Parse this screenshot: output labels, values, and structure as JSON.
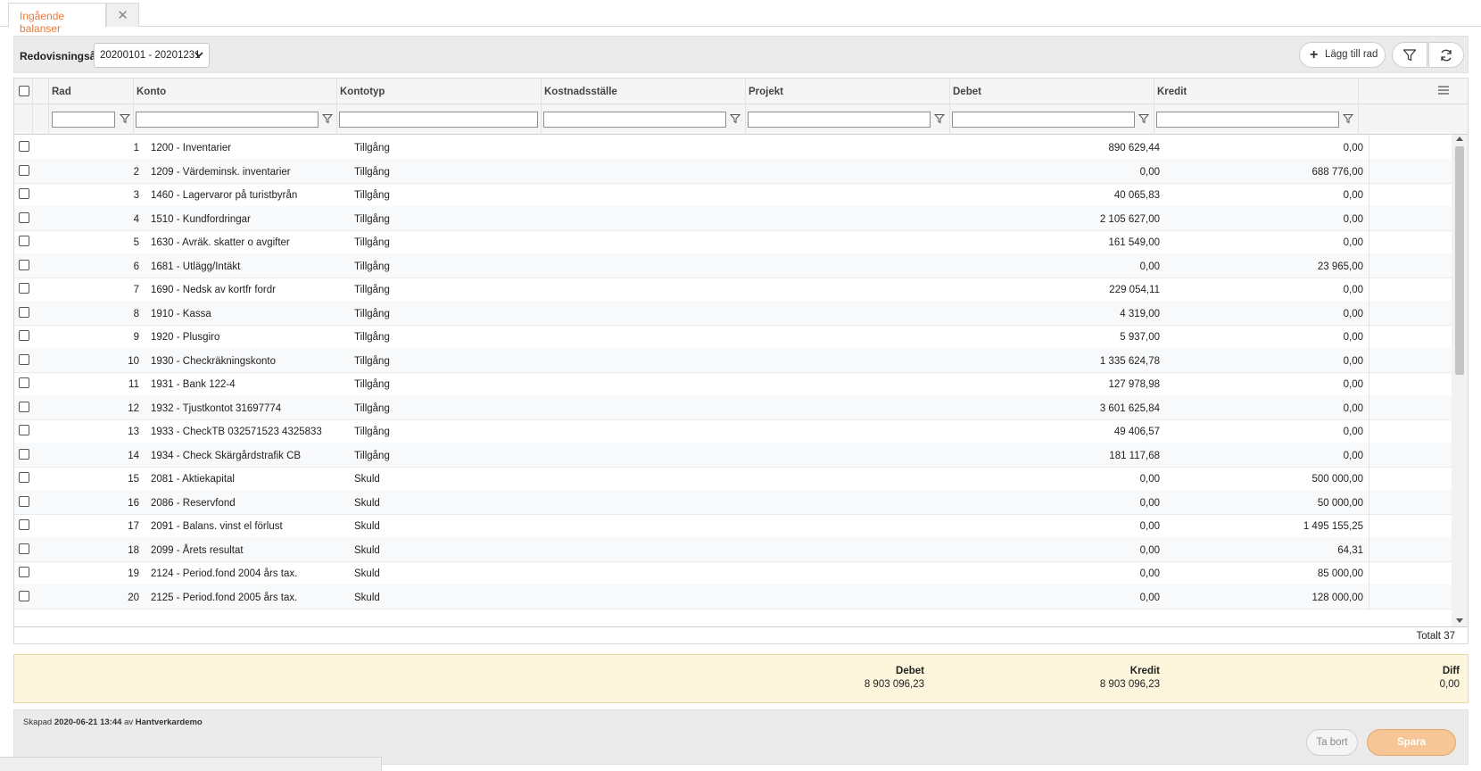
{
  "tabs": {
    "active_label": "Ingående balanser",
    "close_symbol": "✕"
  },
  "toolbar": {
    "year_label": "Redovisningsår",
    "year_value": "20200101 - 20201231",
    "add_row_label": "Lägg till rad"
  },
  "grid": {
    "columns": {
      "rad": "Rad",
      "konto": "Konto",
      "kontotyp": "Kontotyp",
      "kostnadsstalle": "Kostnadsställe",
      "projekt": "Projekt",
      "debet": "Debet",
      "kredit": "Kredit"
    },
    "rows": [
      {
        "rad": "1",
        "konto": "1200 - Inventarier",
        "typ": "Tillgång",
        "debet": "890 629,44",
        "kredit": "0,00"
      },
      {
        "rad": "2",
        "konto": "1209 - Värdeminsk. inventarier",
        "typ": "Tillgång",
        "debet": "0,00",
        "kredit": "688 776,00"
      },
      {
        "rad": "3",
        "konto": "1460 - Lagervaror på turistbyrån",
        "typ": "Tillgång",
        "debet": "40 065,83",
        "kredit": "0,00"
      },
      {
        "rad": "4",
        "konto": "1510 - Kundfordringar",
        "typ": "Tillgång",
        "debet": "2 105 627,00",
        "kredit": "0,00"
      },
      {
        "rad": "5",
        "konto": "1630 - Avräk. skatter o avgifter",
        "typ": "Tillgång",
        "debet": "161 549,00",
        "kredit": "0,00"
      },
      {
        "rad": "6",
        "konto": "1681 - Utlägg/Intäkt",
        "typ": "Tillgång",
        "debet": "0,00",
        "kredit": "23 965,00"
      },
      {
        "rad": "7",
        "konto": "1690 - Nedsk av kortfr fordr",
        "typ": "Tillgång",
        "debet": "229 054,11",
        "kredit": "0,00"
      },
      {
        "rad": "8",
        "konto": "1910 - Kassa",
        "typ": "Tillgång",
        "debet": "4 319,00",
        "kredit": "0,00"
      },
      {
        "rad": "9",
        "konto": "1920 - Plusgiro",
        "typ": "Tillgång",
        "debet": "5 937,00",
        "kredit": "0,00"
      },
      {
        "rad": "10",
        "konto": "1930 - Checkräkningskonto",
        "typ": "Tillgång",
        "debet": "1 335 624,78",
        "kredit": "0,00"
      },
      {
        "rad": "11",
        "konto": "1931 - Bank 122-4",
        "typ": "Tillgång",
        "debet": "127 978,98",
        "kredit": "0,00"
      },
      {
        "rad": "12",
        "konto": "1932 - Tjustkontot 31697774",
        "typ": "Tillgång",
        "debet": "3 601 625,84",
        "kredit": "0,00"
      },
      {
        "rad": "13",
        "konto": "1933 - CheckTB 032571523 4325833",
        "typ": "Tillgång",
        "debet": "49 406,57",
        "kredit": "0,00"
      },
      {
        "rad": "14",
        "konto": "1934 - Check Skärgårdstrafik CB",
        "typ": "Tillgång",
        "debet": "181 117,68",
        "kredit": "0,00"
      },
      {
        "rad": "15",
        "konto": "2081 - Aktiekapital",
        "typ": "Skuld",
        "debet": "0,00",
        "kredit": "500 000,00"
      },
      {
        "rad": "16",
        "konto": "2086 - Reservfond",
        "typ": "Skuld",
        "debet": "0,00",
        "kredit": "50 000,00"
      },
      {
        "rad": "17",
        "konto": "2091 - Balans. vinst el förlust",
        "typ": "Skuld",
        "debet": "0,00",
        "kredit": "1 495 155,25"
      },
      {
        "rad": "18",
        "konto": "2099 - Årets resultat",
        "typ": "Skuld",
        "debet": "0,00",
        "kredit": "64,31"
      },
      {
        "rad": "19",
        "konto": "2124 - Period.fond 2004 års tax.",
        "typ": "Skuld",
        "debet": "0,00",
        "kredit": "85 000,00"
      },
      {
        "rad": "20",
        "konto": "2125 - Period.fond 2005 års tax.",
        "typ": "Skuld",
        "debet": "0,00",
        "kredit": "128 000,00"
      }
    ],
    "total_label": "Totalt 37"
  },
  "summary": {
    "debet_label": "Debet",
    "debet_value": "8 903 096,23",
    "kredit_label": "Kredit",
    "kredit_value": "8 903 096,23",
    "diff_label": "Diff",
    "diff_value": "0,00"
  },
  "footer": {
    "created_prefix": "Skapad",
    "created_date": "2020-06-21 13:44",
    "created_by_word": "av",
    "created_by": "Hantverkardemo",
    "delete_label": "Ta bort",
    "save_label": "Spara"
  },
  "colors": {
    "accent": "#e87a3c",
    "save_button": "#f6c697",
    "summary_bg": "#fdf6dc"
  }
}
